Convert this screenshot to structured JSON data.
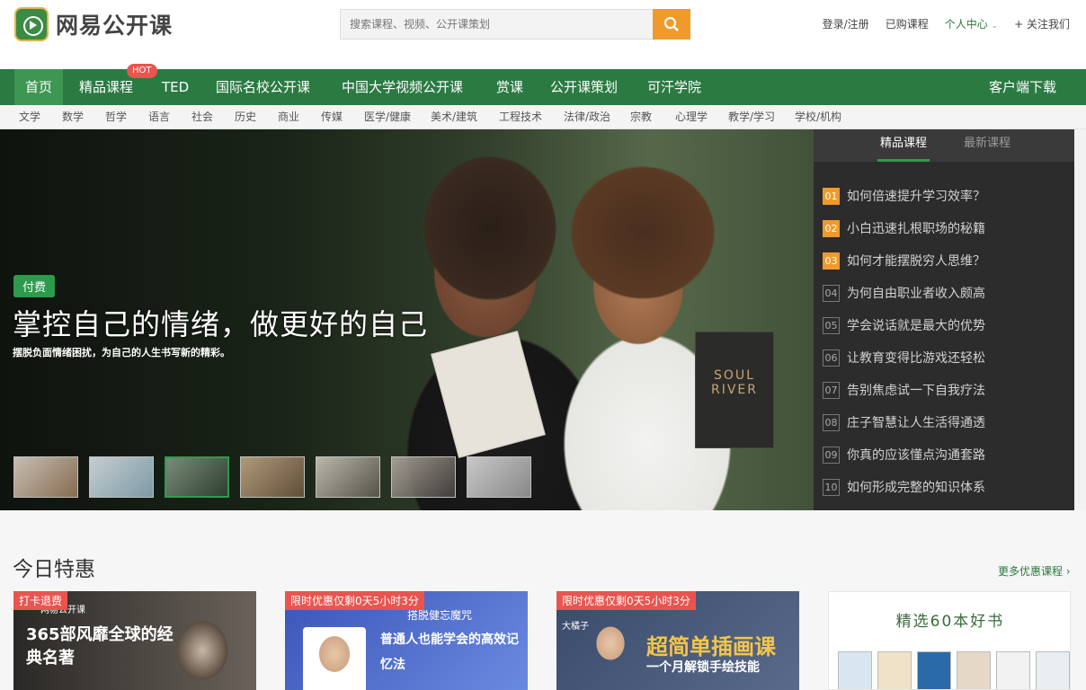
{
  "header": {
    "logo_text": "网易公开课",
    "search_placeholder": "搜索课程、视频、公开课策划",
    "links": {
      "login": "登录/注册",
      "purchased": "已购课程",
      "user_center": "个人中心",
      "follow": "关注我们"
    }
  },
  "nav": {
    "items": [
      "首页",
      "精品课程",
      "TED",
      "国际名校公开课",
      "中国大学视频公开课",
      "赏课",
      "公开课策划",
      "可汗学院"
    ],
    "hot_badge": "HOT",
    "download": "客户端下载"
  },
  "subnav": [
    "文学",
    "数学",
    "哲学",
    "语言",
    "社会",
    "历史",
    "商业",
    "传媒",
    "医学/健康",
    "美术/建筑",
    "工程技术",
    "法律/政治",
    "宗教",
    "心理学",
    "教学/学习",
    "学校/机构"
  ],
  "hero": {
    "tag": "付费",
    "title": "掌控自己的情绪，做更好的自己",
    "subtitle": "摆脱负面情绪困扰，为自己的人生书写新的精彩。",
    "book_text": "SOUL RIVER"
  },
  "rank": {
    "tab_active": "精品课程",
    "tab_other": "最新课程",
    "items": [
      {
        "num": "01",
        "title": "如何倍速提升学习效率？"
      },
      {
        "num": "02",
        "title": "小白迅速扎根职场的秘籍"
      },
      {
        "num": "03",
        "title": "如何才能摆脱穷人思维？"
      },
      {
        "num": "04",
        "title": "为何自由职业者收入颇高"
      },
      {
        "num": "05",
        "title": "学会说话就是最大的优势"
      },
      {
        "num": "06",
        "title": "让教育变得比游戏还轻松"
      },
      {
        "num": "07",
        "title": "告别焦虑试一下自我疗法"
      },
      {
        "num": "08",
        "title": "庄子智慧让人生活得通透"
      },
      {
        "num": "09",
        "title": "你真的应该懂点沟通套路"
      },
      {
        "num": "10",
        "title": "如何形成完整的知识体系"
      }
    ]
  },
  "today": {
    "title": "今日特惠",
    "more": "更多优惠课程",
    "cards": [
      {
        "badge": "打卡退费",
        "brand": "网易公开课",
        "text": "365部风靡全球的经典名著"
      },
      {
        "badge": "限时优惠仅剩0天5小时3分",
        "text_small": "搭脱健忘魔咒",
        "text": "普通人也能学会的高效记忆法"
      },
      {
        "badge": "限时优惠仅剩0天5小时3分",
        "author": "大橘子",
        "text": "超简单插画课",
        "text_small": "一个月解锁手绘技能"
      },
      {
        "text": "精选60本好书"
      }
    ]
  }
}
